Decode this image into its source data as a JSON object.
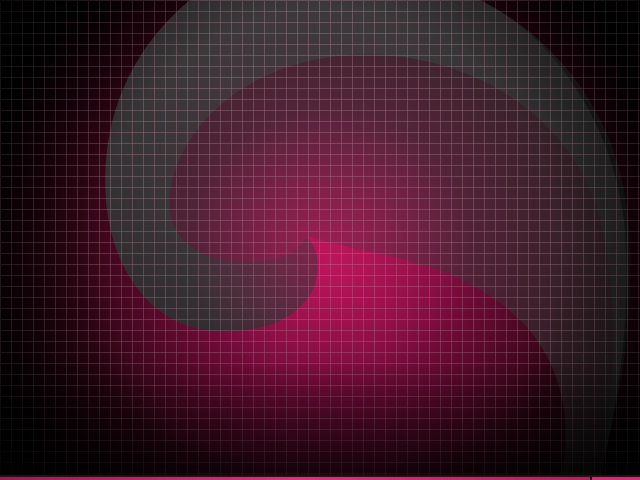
{
  "desktop": {
    "wallpaper": {
      "background_color": "#000000",
      "accent_color": "#e0186a",
      "shape_color": "#4a4a4a",
      "grid_color": "#c8a0b0",
      "style": "pink grid with dark swirl"
    },
    "panel": {
      "accent_color": "#e0307a"
    }
  }
}
